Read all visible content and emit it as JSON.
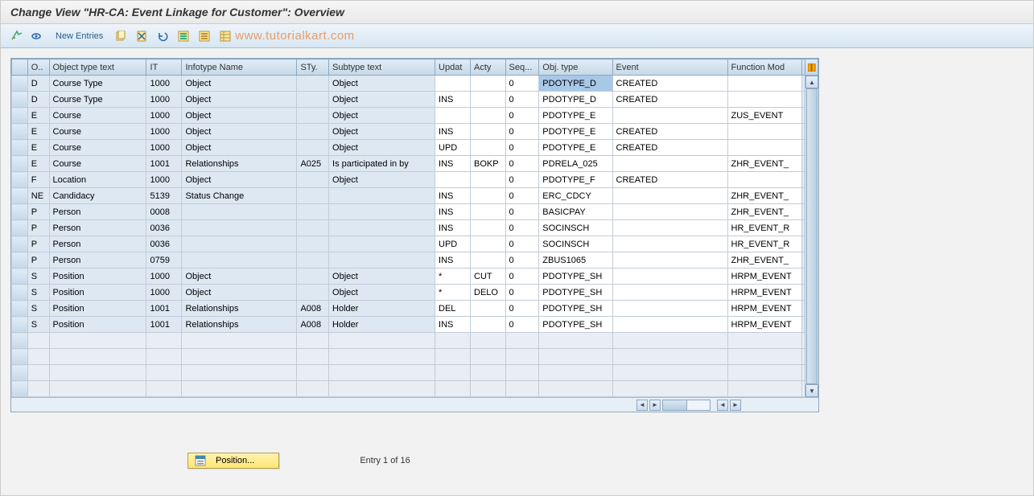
{
  "title": "Change View \"HR-CA: Event Linkage for Customer\": Overview",
  "toolbar": {
    "new_entries": "New Entries",
    "watermark": "www.tutorialkart.com"
  },
  "columns": {
    "o": "O..",
    "ott": "Object type text",
    "it": "IT",
    "itn": "Infotype Name",
    "sty": "STy.",
    "stt": "Subtype text",
    "upd": "Updat",
    "act": "Acty",
    "seq": "Seq...",
    "obj": "Obj. type",
    "evt": "Event",
    "fm": "Function Mod"
  },
  "rows": [
    {
      "o": "D",
      "ott": "Course Type",
      "it": "1000",
      "itn": "Object",
      "sty": "",
      "stt": "Object",
      "upd": "",
      "act": "",
      "seq": "0",
      "obj": "PDOTYPE_D",
      "evt": "CREATED",
      "fm": "",
      "highlight_obj": true
    },
    {
      "o": "D",
      "ott": "Course Type",
      "it": "1000",
      "itn": "Object",
      "sty": "",
      "stt": "Object",
      "upd": "INS",
      "act": "",
      "seq": "0",
      "obj": "PDOTYPE_D",
      "evt": "CREATED",
      "fm": ""
    },
    {
      "o": "E",
      "ott": "Course",
      "it": "1000",
      "itn": "Object",
      "sty": "",
      "stt": "Object",
      "upd": "",
      "act": "",
      "seq": "0",
      "obj": "PDOTYPE_E",
      "evt": "",
      "fm": "ZUS_EVENT"
    },
    {
      "o": "E",
      "ott": "Course",
      "it": "1000",
      "itn": "Object",
      "sty": "",
      "stt": "Object",
      "upd": "INS",
      "act": "",
      "seq": "0",
      "obj": "PDOTYPE_E",
      "evt": "CREATED",
      "fm": ""
    },
    {
      "o": "E",
      "ott": "Course",
      "it": "1000",
      "itn": "Object",
      "sty": "",
      "stt": "Object",
      "upd": "UPD",
      "act": "",
      "seq": "0",
      "obj": "PDOTYPE_E",
      "evt": "CREATED",
      "fm": ""
    },
    {
      "o": "E",
      "ott": "Course",
      "it": "1001",
      "itn": "Relationships",
      "sty": "A025",
      "stt": "Is participated in by",
      "upd": "INS",
      "act": "BOKP",
      "seq": "0",
      "obj": "PDRELA_025",
      "evt": "",
      "fm": "ZHR_EVENT_"
    },
    {
      "o": "F",
      "ott": "Location",
      "it": "1000",
      "itn": "Object",
      "sty": "",
      "stt": "Object",
      "upd": "",
      "act": "",
      "seq": "0",
      "obj": "PDOTYPE_F",
      "evt": "CREATED",
      "fm": ""
    },
    {
      "o": "NE",
      "ott": "Candidacy",
      "it": "5139",
      "itn": "Status Change",
      "sty": "",
      "stt": "",
      "upd": "INS",
      "act": "",
      "seq": "0",
      "obj": "ERC_CDCY",
      "evt": "",
      "fm": "ZHR_EVENT_"
    },
    {
      "o": "P",
      "ott": "Person",
      "it": "0008",
      "itn": "",
      "sty": "",
      "stt": "",
      "upd": "INS",
      "act": "",
      "seq": "0",
      "obj": "BASICPAY",
      "evt": "",
      "fm": "ZHR_EVENT_"
    },
    {
      "o": "P",
      "ott": "Person",
      "it": "0036",
      "itn": "",
      "sty": "",
      "stt": "",
      "upd": "INS",
      "act": "",
      "seq": "0",
      "obj": "SOCINSCH",
      "evt": "",
      "fm": "HR_EVENT_R"
    },
    {
      "o": "P",
      "ott": "Person",
      "it": "0036",
      "itn": "",
      "sty": "",
      "stt": "",
      "upd": "UPD",
      "act": "",
      "seq": "0",
      "obj": "SOCINSCH",
      "evt": "",
      "fm": "HR_EVENT_R"
    },
    {
      "o": "P",
      "ott": "Person",
      "it": "0759",
      "itn": "",
      "sty": "",
      "stt": "",
      "upd": "INS",
      "act": "",
      "seq": "0",
      "obj": "ZBUS1065",
      "evt": "",
      "fm": "ZHR_EVENT_"
    },
    {
      "o": "S",
      "ott": "Position",
      "it": "1000",
      "itn": "Object",
      "sty": "",
      "stt": "Object",
      "upd": "*",
      "act": "CUT",
      "seq": "0",
      "obj": "PDOTYPE_SH",
      "evt": "",
      "fm": "HRPM_EVENT"
    },
    {
      "o": "S",
      "ott": "Position",
      "it": "1000",
      "itn": "Object",
      "sty": "",
      "stt": "Object",
      "upd": "*",
      "act": "DELO",
      "seq": "0",
      "obj": "PDOTYPE_SH",
      "evt": "",
      "fm": "HRPM_EVENT"
    },
    {
      "o": "S",
      "ott": "Position",
      "it": "1001",
      "itn": "Relationships",
      "sty": "A008",
      "stt": "Holder",
      "upd": "DEL",
      "act": "",
      "seq": "0",
      "obj": "PDOTYPE_SH",
      "evt": "",
      "fm": "HRPM_EVENT"
    },
    {
      "o": "S",
      "ott": "Position",
      "it": "1001",
      "itn": "Relationships",
      "sty": "A008",
      "stt": "Holder",
      "upd": "INS",
      "act": "",
      "seq": "0",
      "obj": "PDOTYPE_SH",
      "evt": "",
      "fm": "HRPM_EVENT"
    }
  ],
  "empty_rows": 4,
  "footer": {
    "position_label": "Position...",
    "entry_info": "Entry 1 of 16"
  }
}
